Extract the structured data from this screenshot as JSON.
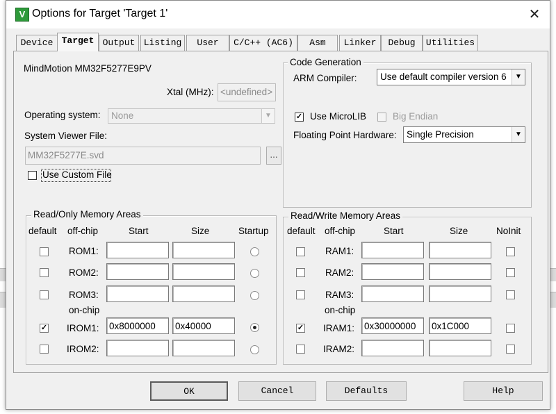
{
  "window": {
    "title": "Options for Target 'Target 1'",
    "icon": "keil-uvision-icon",
    "close_glyph": "✕"
  },
  "tabs": [
    {
      "label": "Device",
      "active": false
    },
    {
      "label": "Target",
      "active": true
    },
    {
      "label": "Output",
      "active": false
    },
    {
      "label": "Listing",
      "active": false
    },
    {
      "label": "User",
      "active": false
    },
    {
      "label": "C/C++ (AC6)",
      "active": false
    },
    {
      "label": "Asm",
      "active": false
    },
    {
      "label": "Linker",
      "active": false
    },
    {
      "label": "Debug",
      "active": false
    },
    {
      "label": "Utilities",
      "active": false
    }
  ],
  "target": {
    "device_name": "MindMotion MM32F5277E9PV",
    "xtal_label": "Xtal (MHz):",
    "xtal_value": "<undefined>",
    "os_label": "Operating system:",
    "os_value": "None",
    "svd_label": "System Viewer File:",
    "svd_value": "MM32F5277E.svd",
    "browse_label": "...",
    "custom_file_label": "Use Custom File",
    "custom_file_checked": false
  },
  "code_gen": {
    "title": "Code Generation",
    "compiler_label": "ARM Compiler:",
    "compiler_value": "Use default compiler version 6",
    "microlib_label": "Use MicroLIB",
    "microlib_checked": true,
    "big_endian_label": "Big Endian",
    "big_endian_checked": false,
    "fph_label": "Floating Point Hardware:",
    "fph_value": "Single Precision"
  },
  "ro_memory": {
    "title": "Read/Only Memory Areas",
    "headers": {
      "default": "default",
      "offchip": "off-chip",
      "start": "Start",
      "size": "Size",
      "startup": "Startup"
    },
    "onchip_label": "on-chip",
    "rows": [
      {
        "name": "ROM1:",
        "default": false,
        "start": "",
        "size": "",
        "startup": false
      },
      {
        "name": "ROM2:",
        "default": false,
        "start": "",
        "size": "",
        "startup": false
      },
      {
        "name": "ROM3:",
        "default": false,
        "start": "",
        "size": "",
        "startup": false
      },
      {
        "name": "IROM1:",
        "default": true,
        "start": "0x8000000",
        "size": "0x40000",
        "startup": true
      },
      {
        "name": "IROM2:",
        "default": false,
        "start": "",
        "size": "",
        "startup": false
      }
    ]
  },
  "rw_memory": {
    "title": "Read/Write Memory Areas",
    "headers": {
      "default": "default",
      "offchip": "off-chip",
      "start": "Start",
      "size": "Size",
      "noinit": "NoInit"
    },
    "onchip_label": "on-chip",
    "rows": [
      {
        "name": "RAM1:",
        "default": false,
        "start": "",
        "size": "",
        "noinit": false
      },
      {
        "name": "RAM2:",
        "default": false,
        "start": "",
        "size": "",
        "noinit": false
      },
      {
        "name": "RAM3:",
        "default": false,
        "start": "",
        "size": "",
        "noinit": false
      },
      {
        "name": "IRAM1:",
        "default": true,
        "start": "0x30000000",
        "size": "0x1C000",
        "noinit": false
      },
      {
        "name": "IRAM2:",
        "default": false,
        "start": "",
        "size": "",
        "noinit": false
      }
    ]
  },
  "buttons": {
    "ok": "OK",
    "cancel": "Cancel",
    "defaults": "Defaults",
    "help": "Help"
  },
  "check_glyph": "✓",
  "dropdown_glyph": "▼"
}
